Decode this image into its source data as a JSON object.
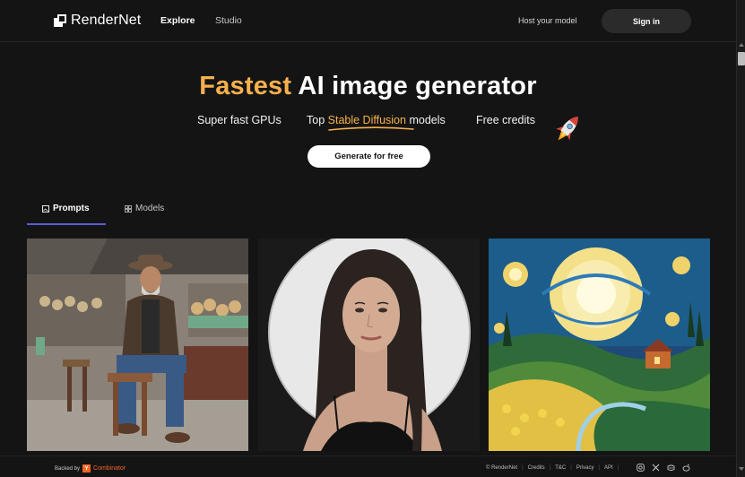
{
  "header": {
    "brand": "RenderNet",
    "nav": {
      "explore": "Explore",
      "studio": "Studio"
    },
    "host_link": "Host your model",
    "signin": "Sign in"
  },
  "hero": {
    "title_accent": "Fastest",
    "title_rest": "AI image generator",
    "feature1": "Super fast GPUs",
    "feature2_prefix": "Top",
    "feature2_highlight": "Stable Diffusion",
    "feature2_suffix": "models",
    "feature3": "Free credits",
    "cta": "Generate for free"
  },
  "tabs": {
    "prompts": "Prompts",
    "models": "Models"
  },
  "gallery": {
    "icons": [
      "market-vendor-photo",
      "portrait-photo",
      "starry-landscape-painting"
    ]
  },
  "footer": {
    "backed_by": "Backed by",
    "yc_letter": "Y",
    "yc_name": "Combinator",
    "copyright": "© RenderNet",
    "links": [
      "Credits",
      "T&C",
      "Privacy",
      "API"
    ]
  },
  "colors": {
    "accent": "#f6b14e",
    "background": "#141414",
    "tab_indicator": "#5b5bd6",
    "yc": "#f26625"
  }
}
